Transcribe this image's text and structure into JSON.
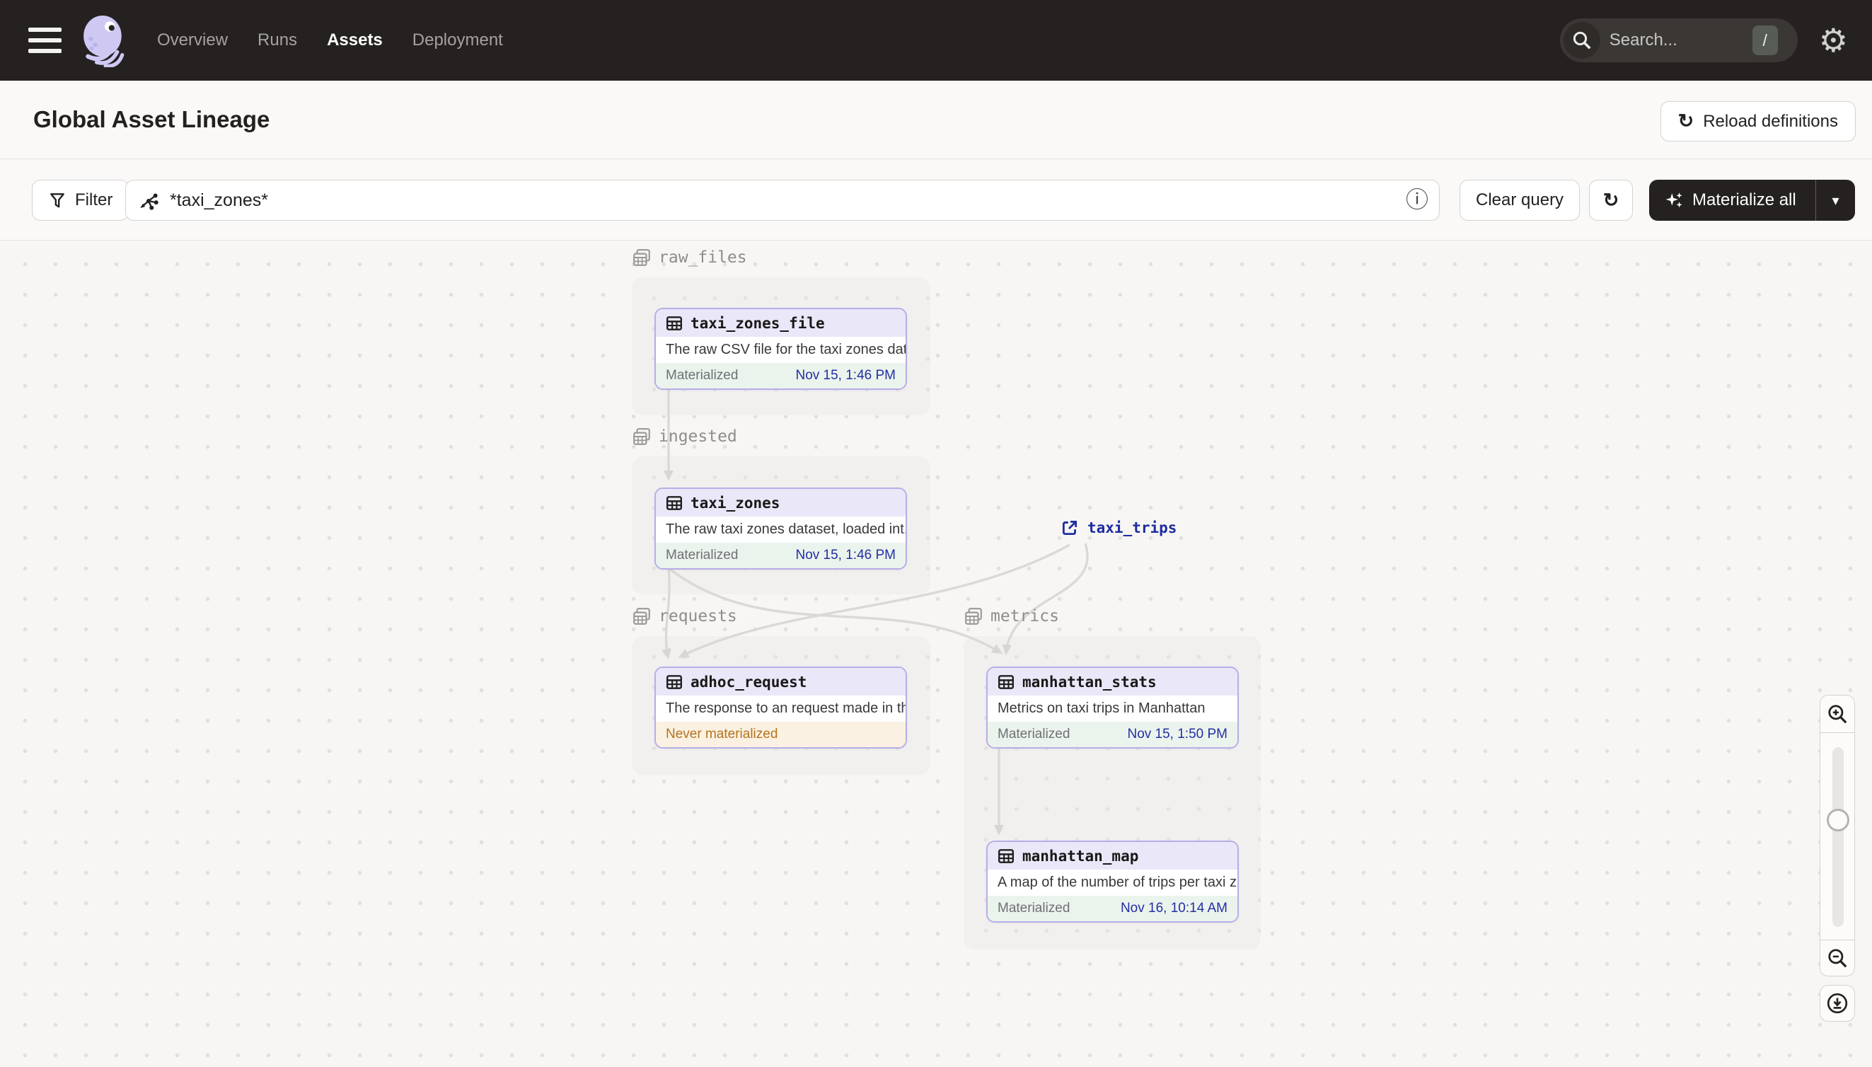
{
  "colors": {
    "topbar_bg": "#242120",
    "accent_lavender_border": "#B7AEE8",
    "node_header_bg": "#EAE7F8",
    "materialized_bg": "#EBF3ED",
    "materialized_time_text": "#2330A4",
    "never_materialized_text": "#B5731C",
    "never_materialized_bg": "#FAF1E2",
    "external_link_text": "#1E2DA0"
  },
  "topbar": {
    "nav": [
      {
        "label": "Overview"
      },
      {
        "label": "Runs"
      },
      {
        "label": "Assets"
      },
      {
        "label": "Deployment"
      }
    ],
    "active_nav": "Assets",
    "search": {
      "placeholder": "Search...",
      "shortcut": "/"
    }
  },
  "header": {
    "title": "Global Asset Lineage",
    "reload_button": "Reload definitions"
  },
  "toolbar": {
    "filter_button": "Filter",
    "query_value": "*taxi_zones*",
    "clear_button": "Clear query",
    "materialize_button": "Materialize all"
  },
  "lineage": {
    "groups": [
      {
        "label": "raw_files"
      },
      {
        "label": "ingested"
      },
      {
        "label": "requests"
      },
      {
        "label": "metrics"
      }
    ],
    "assets": [
      {
        "name": "taxi_zones_file",
        "description": "The raw CSV file for the taxi zones dat...",
        "status": "Materialized",
        "time": "Nov 15, 1:46 PM"
      },
      {
        "name": "taxi_zones",
        "description": "The raw taxi zones dataset, loaded int...",
        "status": "Materialized",
        "time": "Nov 15, 1:46 PM"
      },
      {
        "name": "adhoc_request",
        "description": "The response to an request made in th...",
        "status": "Never materialized",
        "time": ""
      },
      {
        "name": "manhattan_stats",
        "description": "Metrics on taxi trips in Manhattan",
        "status": "Materialized",
        "time": "Nov 15, 1:50 PM"
      },
      {
        "name": "manhattan_map",
        "description": "A map of the number of trips per taxi z...",
        "status": "Materialized",
        "time": "Nov 16, 10:14 AM"
      }
    ],
    "external_assets": [
      {
        "name": "taxi_trips"
      }
    ]
  }
}
